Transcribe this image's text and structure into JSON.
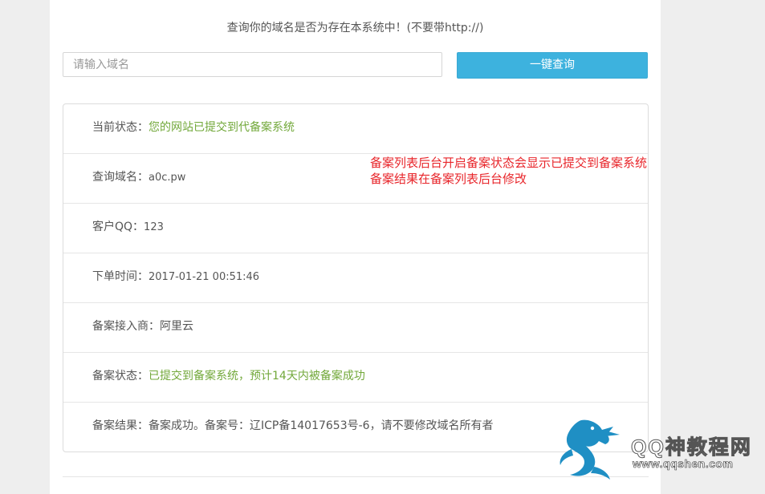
{
  "header": {
    "title": "查询你的域名是否为存在本系统中！(不要带http://)"
  },
  "search": {
    "placeholder": "请输入域名",
    "value": "",
    "button_label": "一键查询"
  },
  "result": {
    "rows": [
      {
        "label": "当前状态：",
        "value": "您的网站已提交到代备案系统"
      },
      {
        "label": "查询域名：",
        "value": "a0c.pw"
      },
      {
        "label": "客户QQ：",
        "value": "123"
      },
      {
        "label": "下单时间：",
        "value": "2017-01-21 00:51:46"
      },
      {
        "label": "备案接入商：",
        "value": "阿里云"
      },
      {
        "label": "备案状态：",
        "value": "已提交到备案系统，预计14天内被备案成功"
      },
      {
        "label": "备案结果：",
        "value": "备案成功。备案号：辽ICP备14017653号-6，请不要修改域名所有者"
      }
    ]
  },
  "annotation": {
    "line1": "备案列表后台开启备案状态会显示已提交到备案系统",
    "line2": "备案结果在备案列表后台修改",
    "color": "#e8262b"
  },
  "watermark": {
    "title": "QQ神教程网",
    "url": "www.qqshen.com",
    "icon": "dragon-logo"
  },
  "colors": {
    "accent": "#3db2de",
    "success": "#72a83a"
  }
}
